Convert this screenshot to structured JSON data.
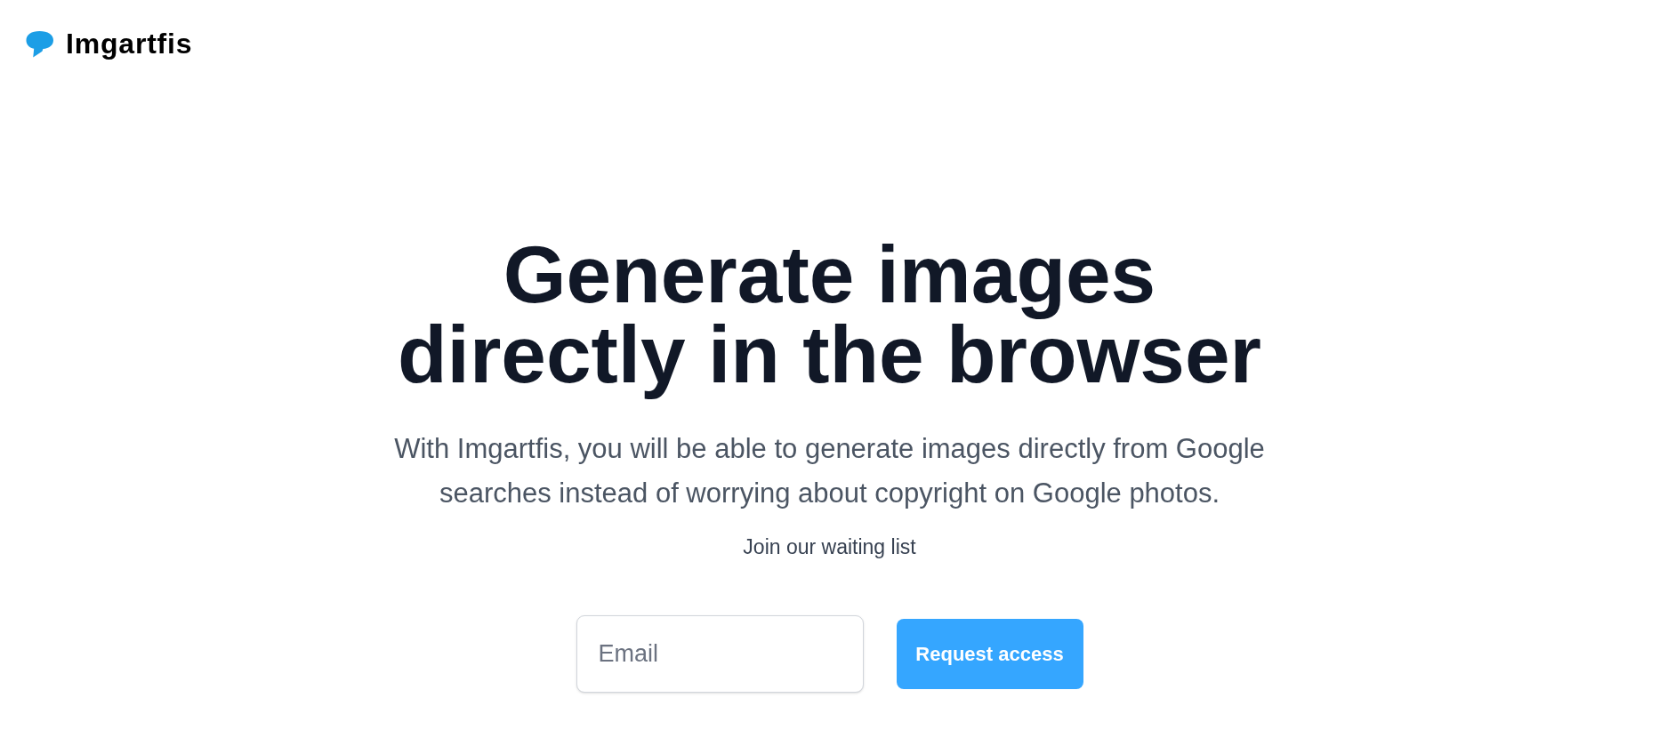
{
  "logo": {
    "name": "Imgartfis"
  },
  "hero": {
    "heading": "Generate images directly in the browser",
    "description": "With Imgartfis, you will be able to generate images directly from Google searches instead of worrying about copyright on Google photos.",
    "waitlist_label": "Join our waiting list"
  },
  "signup_form": {
    "email_field": {
      "placeholder": "Email"
    },
    "submit_button": "Request access"
  }
}
